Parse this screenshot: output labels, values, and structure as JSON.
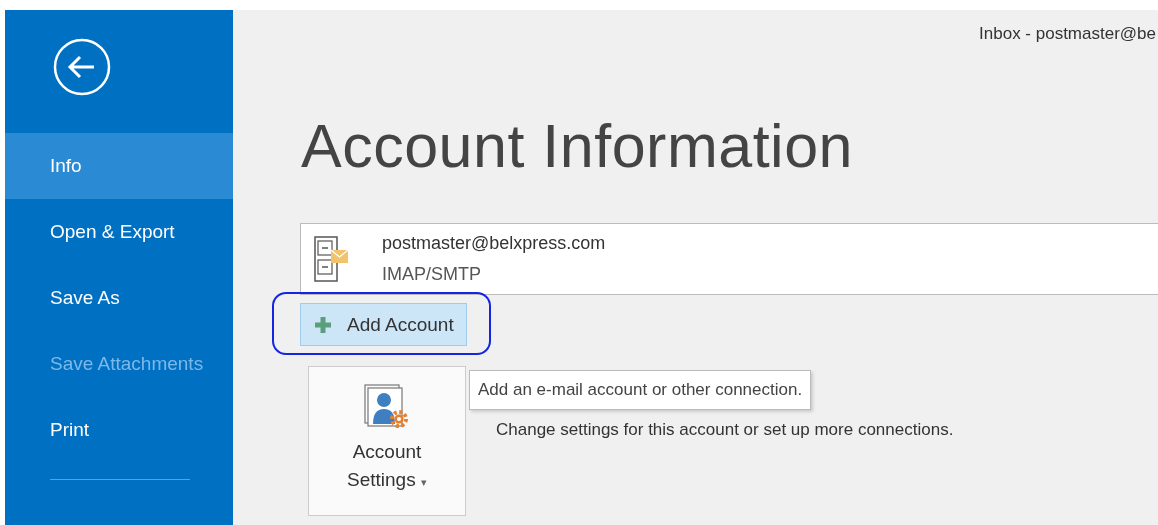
{
  "window": {
    "title": "Inbox - postmaster@be"
  },
  "sidebar": {
    "items": [
      {
        "label": "Info",
        "selected": true,
        "disabled": false
      },
      {
        "label": "Open & Export",
        "selected": false,
        "disabled": false
      },
      {
        "label": "Save As",
        "selected": false,
        "disabled": false
      },
      {
        "label": "Save Attachments",
        "selected": false,
        "disabled": true
      },
      {
        "label": "Print",
        "selected": false,
        "disabled": false
      }
    ]
  },
  "heading": "Account Information",
  "account": {
    "email": "postmaster@belxpress.com",
    "type": "IMAP/SMTP"
  },
  "add_account": {
    "label": "Add Account",
    "highlighted": true
  },
  "tooltip": "Add an e-mail account or other connection.",
  "account_settings": {
    "label_line_1": "Account",
    "label_line_2": "Settings",
    "caret": "▾",
    "description": "Change settings for this account or set up more connections."
  }
}
